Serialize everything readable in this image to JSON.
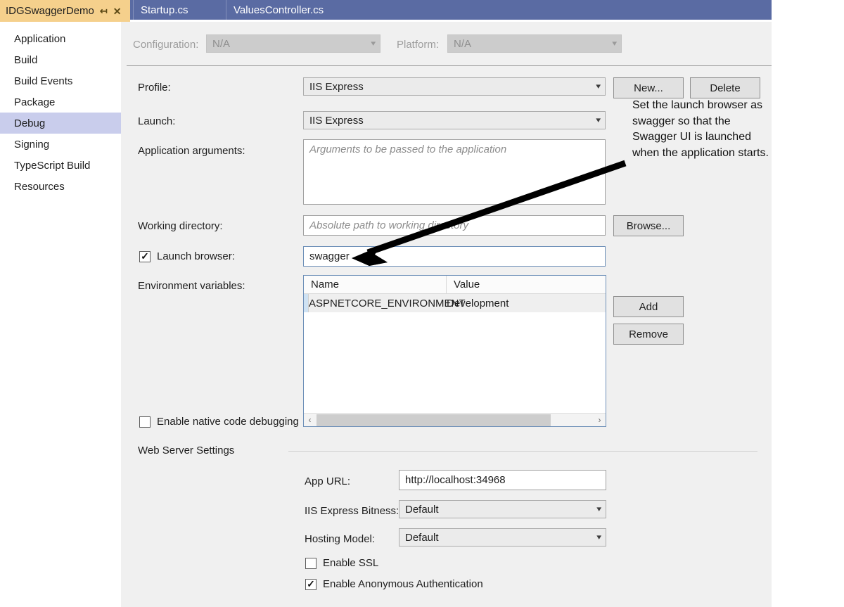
{
  "window": {
    "active_tab": "IDGSwaggerDemo",
    "pin_icon": "pin-icon",
    "close_icon": "close-icon",
    "tabs": [
      {
        "label": "Startup.cs"
      },
      {
        "label": "ValuesController.cs"
      }
    ]
  },
  "sidebar": {
    "items": [
      {
        "label": "Application",
        "selected": false
      },
      {
        "label": "Build",
        "selected": false
      },
      {
        "label": "Build Events",
        "selected": false
      },
      {
        "label": "Package",
        "selected": false
      },
      {
        "label": "Debug",
        "selected": true
      },
      {
        "label": "Signing",
        "selected": false
      },
      {
        "label": "TypeScript Build",
        "selected": false
      },
      {
        "label": "Resources",
        "selected": false
      }
    ]
  },
  "topbar": {
    "configuration_label": "Configuration:",
    "configuration_value": "N/A",
    "platform_label": "Platform:",
    "platform_value": "N/A"
  },
  "form": {
    "profile_label": "Profile:",
    "profile_value": "IIS Express",
    "new_button": "New...",
    "delete_button": "Delete",
    "launch_label": "Launch:",
    "launch_value": "IIS Express",
    "app_args_label": "Application arguments:",
    "app_args_value": "",
    "app_args_placeholder": "Arguments to be passed to the application",
    "working_dir_label": "Working directory:",
    "working_dir_value": "",
    "working_dir_placeholder": "Absolute path to working directory",
    "browse_button": "Browse...",
    "launch_browser_label": "Launch browser:",
    "launch_browser_checked": true,
    "launch_browser_value": "swagger",
    "env_vars_label": "Environment variables:",
    "add_button": "Add",
    "remove_button": "Remove",
    "native_debug_label": "Enable native code debugging",
    "native_debug_checked": false
  },
  "env_grid": {
    "columns": [
      "Name",
      "Value"
    ],
    "rows": [
      {
        "name": "ASPNETCORE_ENVIRONMENT",
        "value": "Development"
      }
    ],
    "scroll_left_icon": "chevron-left-icon",
    "scroll_right_icon": "chevron-right-icon"
  },
  "web_server": {
    "section_title": "Web Server Settings",
    "app_url_label": "App URL:",
    "app_url_value": "http://localhost:34968",
    "bitness_label": "IIS Express Bitness:",
    "bitness_value": "Default",
    "hosting_label": "Hosting Model:",
    "hosting_value": "Default",
    "ssl_label": "Enable SSL",
    "ssl_checked": false,
    "anon_auth_label": "Enable Anonymous Authentication",
    "anon_auth_checked": true
  },
  "annotation": {
    "text": "Set the launch browser as swagger so that the Swagger UI is launched when the application starts."
  },
  "colors": {
    "tabstrip": "#5a6ba3",
    "active_tab": "#f5d08c",
    "sidebar_selected": "#c9cdec",
    "panel_bg": "#f0f0f0",
    "annotation_arrow": "#000000"
  }
}
